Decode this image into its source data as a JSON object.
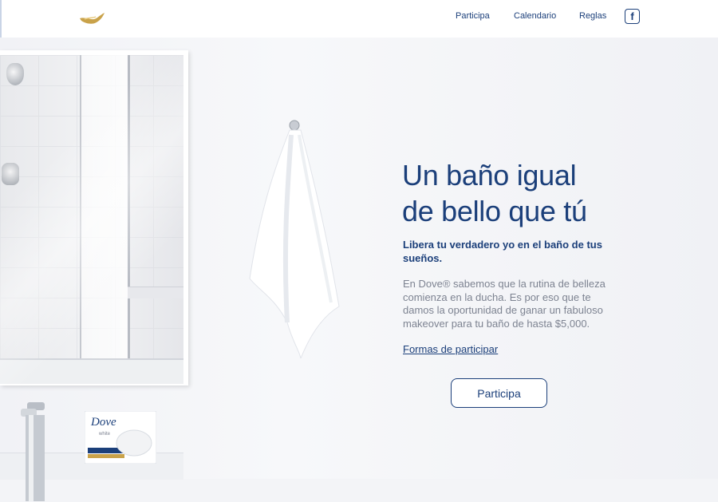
{
  "header": {
    "logo_icon": "dove-bird-icon",
    "nav": [
      {
        "label": "Participa"
      },
      {
        "label": "Calendario"
      },
      {
        "label": "Reglas"
      }
    ],
    "social_icon": "facebook-icon",
    "social_glyph": "f"
  },
  "hero": {
    "headline_line1": "Un baño igual",
    "headline_line2": "de bello que tú",
    "subhead": "Libera tu verdadero yo en el baño de tus sueños.",
    "body": "En Dove® sabemos que la rutina de belleza comienza en la ducha. Es por eso que te damos la oportunidad de ganar un fabuloso makeover para tu baño de hasta $5,000.",
    "link_label": "Formas de participar",
    "cta_label": "Participa"
  },
  "product": {
    "brand": "Dove",
    "variant": "white"
  },
  "colors": {
    "brand_blue": "#1b3f7a",
    "body_gray": "#7d8391",
    "logo_gold": "#c9a24a"
  }
}
